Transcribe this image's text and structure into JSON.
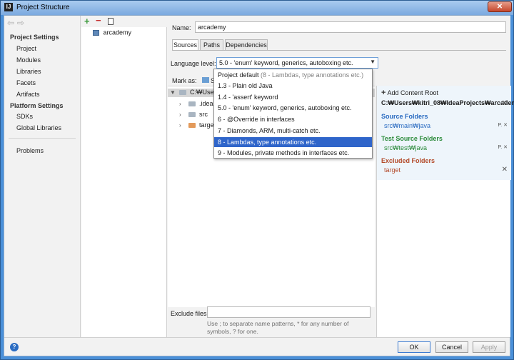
{
  "window": {
    "title": "Project Structure",
    "close_label": "✕",
    "app_icon_label": "IJ"
  },
  "nav": {
    "project_settings": "Project Settings",
    "ps_items": [
      "Project",
      "Modules",
      "Libraries",
      "Facets",
      "Artifacts"
    ],
    "platform_settings": "Platform Settings",
    "pl_items": [
      "SDKs",
      "Global Libraries"
    ],
    "problems": "Problems"
  },
  "modules": {
    "items": [
      "arcademy"
    ]
  },
  "module": {
    "name_label": "Name:",
    "name_value": "arcademy",
    "tabs": [
      "Sources",
      "Paths",
      "Dependencies"
    ],
    "language_level_label": "Language level:",
    "language_level_value": "5.0 - 'enum' keyword, generics, autoboxing etc.",
    "mark_as_label": "Mark as:",
    "mark_as_partial": "So",
    "tree": {
      "root": "C:₩Users₩",
      "children": [
        ".idea",
        "src",
        "target"
      ]
    },
    "exclude_label": "Exclude files:",
    "exclude_value": "",
    "exclude_help": "Use ; to separate name patterns, * for any number of symbols, ? for one."
  },
  "roots": {
    "add_content_root": "Add Content Root",
    "path": "C:₩Users₩kitri_08₩IdeaProjects₩arcademy",
    "source_title": "Source Folders",
    "source_items": [
      "src₩main₩java"
    ],
    "test_title": "Test Source Folders",
    "test_items": [
      "src₩test₩java"
    ],
    "excluded_title": "Excluded Folders",
    "excluded_items": [
      "target"
    ]
  },
  "dropdown": {
    "options": [
      {
        "label": "Project default",
        "muted": " (8 - Lambdas, type annotations etc.)"
      },
      {
        "label": "1.3 - Plain old Java",
        "muted": ""
      },
      {
        "label": "1.4 - 'assert' keyword",
        "muted": ""
      },
      {
        "label": "5.0 - 'enum' keyword, generics, autoboxing etc.",
        "muted": ""
      },
      {
        "label": "6 - @Override in interfaces",
        "muted": ""
      },
      {
        "label": "7 - Diamonds, ARM, multi-catch etc.",
        "muted": ""
      },
      {
        "label": "8 - Lambdas, type annotations etc.",
        "muted": ""
      },
      {
        "label": "9 - Modules, private methods in interfaces etc.",
        "muted": ""
      }
    ],
    "selected_index": 6
  },
  "buttons": {
    "ok": "OK",
    "cancel": "Cancel",
    "apply": "Apply",
    "help": "?"
  },
  "colors": {
    "accent": "#2f65ca",
    "source": "#2a6bc1",
    "test": "#2a8a3a",
    "excluded": "#b34a2a"
  }
}
